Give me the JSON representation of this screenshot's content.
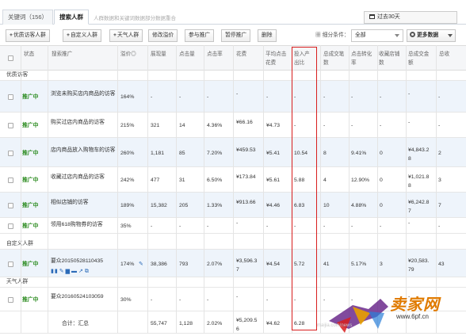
{
  "tabs": {
    "keywords": "关键词（156）",
    "audience": "搜索人群",
    "note": "人群数据和关键词数据部分数据重合"
  },
  "date_range": "过去30天",
  "toolbar": {
    "add_quality": "优质访客人群",
    "add_custom": "自定义人群",
    "add_weather": "天气人群",
    "modify_bid": "修改溢价",
    "join_promo": "参与推广",
    "pause_promo": "暂停推广",
    "delete": "删除",
    "filter_label": "细分条件：",
    "filter_value": "全部",
    "more_data": "更多数据"
  },
  "columns": [
    "状态",
    "搜索推广",
    "溢价◎",
    "展现量",
    "点击量",
    "点击率",
    "花费",
    "平均点击花费",
    "投入产出比",
    "总成交笔数",
    "点击转化率",
    "收藏店铺数",
    "总成交金额",
    "总收"
  ],
  "groups": {
    "g1": "优质访客",
    "g2": "自定义人群",
    "g3": "天气人群"
  },
  "rows": [
    {
      "status": "推广中",
      "name": "浏览未购买店内商品的访客",
      "premium": "164%",
      "impr": "-",
      "clicks": "-",
      "ctr": "-",
      "cost": "-",
      "cpc": "-",
      "roi": "-",
      "orders": "-",
      "cvr": "-",
      "fav": "-",
      "gmv": "-",
      "fav2": "-"
    },
    {
      "status": "推广中",
      "name": "购买过店内商品的访客",
      "premium": "215%",
      "impr": "321",
      "clicks": "14",
      "ctr": "4.36%",
      "cost": "¥66.16",
      "cpc": "¥4.73",
      "roi": "-",
      "orders": "-",
      "cvr": "-",
      "fav": "-",
      "gmv": "-",
      "fav2": "-"
    },
    {
      "status": "推广中",
      "name": "店内商品放入购物车的访客",
      "premium": "260%",
      "impr": "1,181",
      "clicks": "85",
      "ctr": "7.20%",
      "cost": "¥459.53",
      "cpc": "¥5.41",
      "roi": "10.54",
      "orders": "8",
      "cvr": "9.41%",
      "fav": "0",
      "gmv": "¥4,843.28",
      "fav2": "2"
    },
    {
      "status": "推广中",
      "name": "收藏过店内商品的访客",
      "premium": "242%",
      "impr": "477",
      "clicks": "31",
      "ctr": "6.50%",
      "cost": "¥173.84",
      "cpc": "¥5.61",
      "roi": "5.88",
      "orders": "4",
      "cvr": "12.90%",
      "fav": "0",
      "gmv": "¥1,021.88",
      "fav2": "3"
    },
    {
      "status": "推广中",
      "name": "相似店铺的访客",
      "premium": "189%",
      "impr": "15,382",
      "clicks": "205",
      "ctr": "1.33%",
      "cost": "¥913.66",
      "cpc": "¥4.46",
      "roi": "6.83",
      "orders": "10",
      "cvr": "4.88%",
      "fav": "0",
      "gmv": "¥6,242.87",
      "fav2": "7"
    },
    {
      "status": "推广中",
      "name": "领用618购物券的访客",
      "premium": "35%",
      "impr": "-",
      "clicks": "-",
      "ctr": "-",
      "cost": "-",
      "cpc": "-",
      "roi": "-",
      "orders": "-",
      "cvr": "-",
      "fav": "-",
      "gmv": "-",
      "fav2": "-"
    },
    {
      "status": "推广中",
      "name": "要众20150528110435",
      "premium": "174%",
      "impr": "38,386",
      "clicks": "793",
      "ctr": "2.07%",
      "cost": "¥3,596.37",
      "cpc": "¥4.54",
      "roi": "5.72",
      "orders": "41",
      "cvr": "5.17%",
      "fav": "3",
      "gmv": "¥20,583.79",
      "fav2": "43"
    },
    {
      "status": "推广中",
      "name": "要众20160524103059",
      "premium": "30%",
      "impr": "-",
      "clicks": "-",
      "ctr": "-",
      "cost": "-",
      "cpc": "-",
      "roi": "-",
      "orders": "-",
      "cvr": "-",
      "fav": "-",
      "gmv": "-",
      "fav2": "-"
    }
  ],
  "total": {
    "label": "合计：汇总",
    "impr": "55,747",
    "clicks": "1,128",
    "ctr": "2.02%",
    "cost": "¥5,209.56",
    "cpc": "¥4.62",
    "roi": "6.28"
  },
  "watermark": {
    "brand": "卖家网",
    "url": "www.6pf.cn",
    "faint": "maijia.com/news"
  },
  "colors": {
    "status_green": "#2a8a1e",
    "highlight_red": "#d81e1e",
    "row_blue": "#eef4fb"
  }
}
